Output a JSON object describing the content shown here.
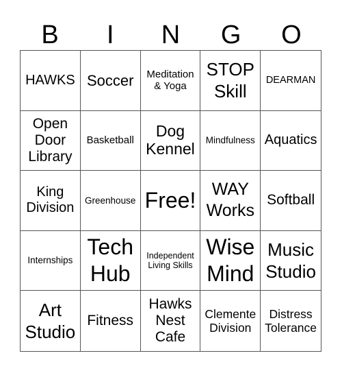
{
  "title_letters": [
    "B",
    "I",
    "N",
    "G",
    "O"
  ],
  "grid": [
    [
      "HAWKS",
      "Soccer",
      "Meditation & Yoga",
      "STOP Skill",
      "DEARMAN"
    ],
    [
      "Open Door Library",
      "Basketball",
      "Dog Kennel",
      "Mindfulness",
      "Aquatics"
    ],
    [
      "King Division",
      "Greenhouse",
      "Free!",
      "WAY Works",
      "Softball"
    ],
    [
      "Internships",
      "Tech Hub",
      "Independent Living Skills",
      "Wise Mind",
      "Music Studio"
    ],
    [
      "Art Studio",
      "Fitness",
      "Hawks Nest Cafe",
      "Clemente Division",
      "Distress Tolerance"
    ]
  ],
  "free_space": "Free!"
}
